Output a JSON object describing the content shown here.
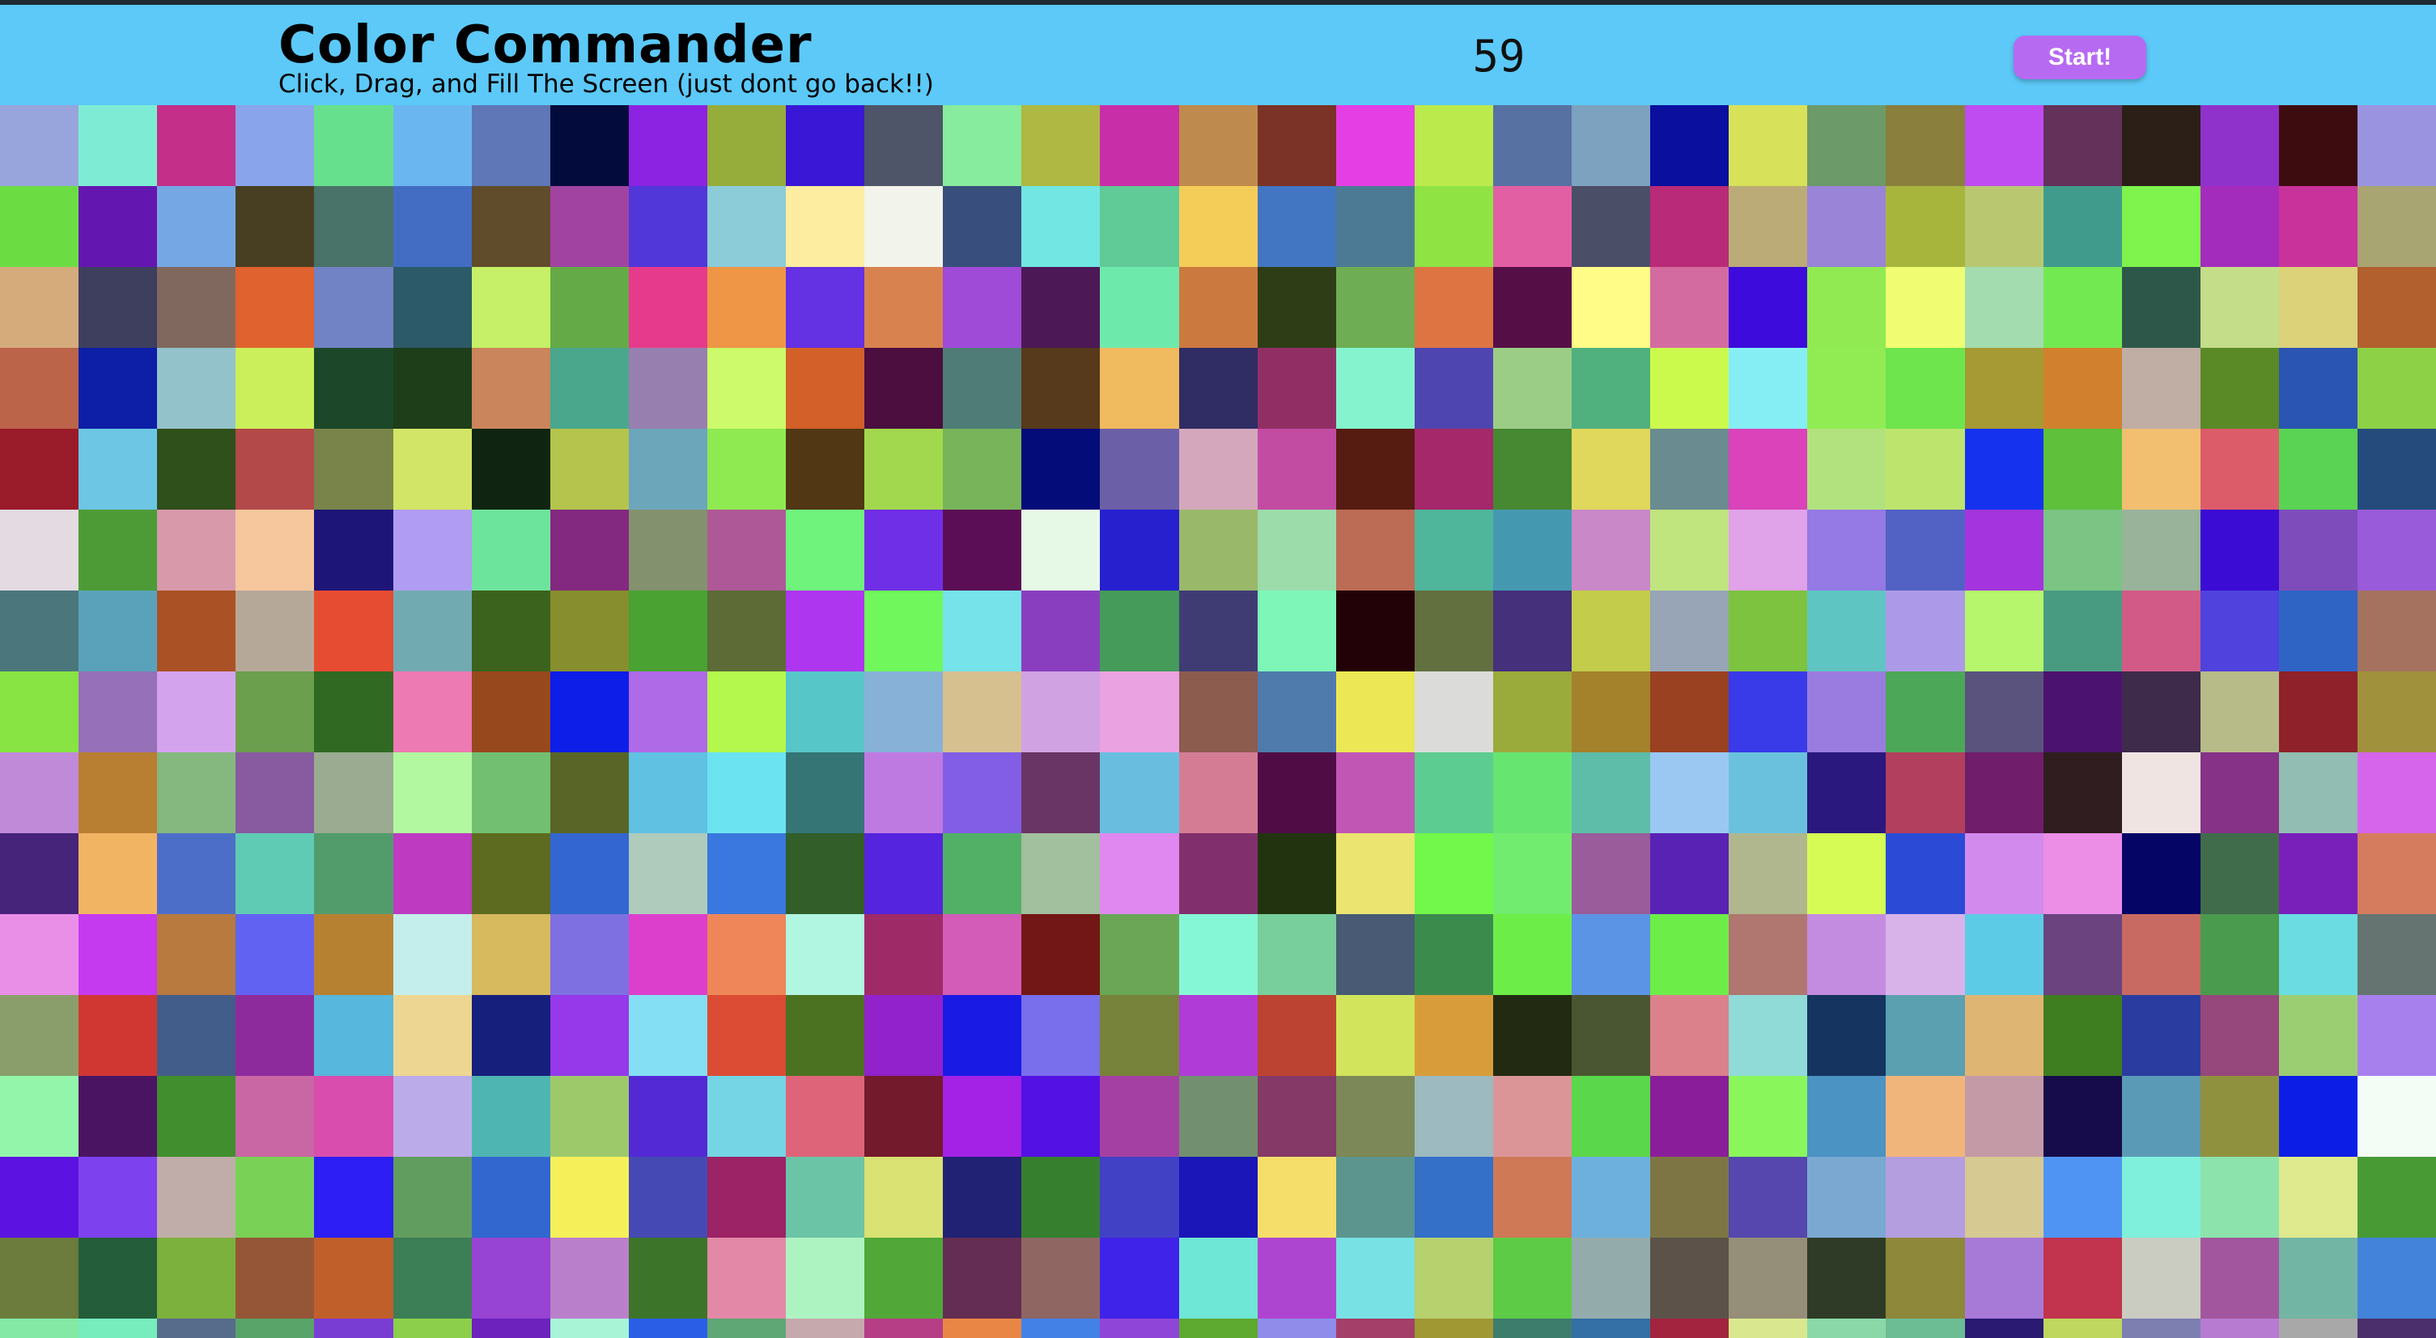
{
  "header": {
    "title": "Color Commander",
    "subtitle": "Click, Drag, and Fill The Screen (just dont go back!!)",
    "counter": "59",
    "start_label": "Start!"
  },
  "colors": {
    "header_bg": "#5cc9f8",
    "button_bg": "#b66af2",
    "top_border": "#1f2a33"
  },
  "grid": {
    "rows": [
      [
        "#98a5dc",
        "#7eecd4",
        "#c42f8a",
        "#8aa4ec",
        "#67e08d",
        "#6ab6f1",
        "#5f77b6",
        "#020b3c",
        "#8d23e2",
        "#96ad3c",
        "#3a16d7",
        "#4e5569",
        "#87ec9e",
        "#aeb842",
        "#c82ea7",
        "#bf8a4d",
        "#7b3227",
        "#e53ee5",
        "#bbea4d",
        "#5771a2",
        "#7ca2bf",
        "#0a0f9e",
        "#d8e15a",
        "#6d9a69",
        "#8a7f3c",
        "#bf4cf1",
        "#64315b",
        "#2b1f17",
        "#8f31cb",
        "#3d0c0e",
        "#9a94e0"
      ],
      [
        "#6bdd43",
        "#6417b0",
        "#76a7e5",
        "#483f22",
        "#497369",
        "#426dc3",
        "#604b2a",
        "#a143a1",
        "#5137d9",
        "#8ccbd8",
        "#fdeda0",
        "#f2f3ea",
        "#384e7c",
        "#72e6e2",
        "#60cb96",
        "#f3cd57",
        "#4276c3",
        "#4c7a94",
        "#8fe343",
        "#e25fa4",
        "#4a4e66",
        "#b92a79",
        "#bbab76",
        "#9a84d8",
        "#a7b53d",
        "#b9c771",
        "#419b8d",
        "#7ef44d",
        "#a42cbd",
        "#c9329a",
        "#a8a572"
      ],
      [
        "#d5ab7c",
        "#3e3e5f",
        "#81685e",
        "#e0622f",
        "#7183c5",
        "#2d5a68",
        "#c6f067",
        "#64ab47",
        "#e63b8c",
        "#ee9646",
        "#6431e3",
        "#d8834f",
        "#a04ad8",
        "#4c1856",
        "#6ee9ac",
        "#cc7940",
        "#2f3d16",
        "#6fad54",
        "#dd7442",
        "#560f46",
        "#fffc87",
        "#d36ba1",
        "#3d0cdc",
        "#91ea51",
        "#f0fd72",
        "#a3dcae",
        "#72e951",
        "#2d5849",
        "#c3dd88",
        "#dbd27a",
        "#b2602e"
      ],
      [
        "#bc6449",
        "#0d1fa6",
        "#93c2ca",
        "#cbee5b",
        "#1c4729",
        "#1d3e19",
        "#cb855c",
        "#4aa78c",
        "#977fb0",
        "#ccfa6a",
        "#d26028",
        "#4b0e3f",
        "#4f7c77",
        "#57391b",
        "#f0ba5e",
        "#302c64",
        "#912f64",
        "#85f3cd",
        "#4f45b0",
        "#9bcd87",
        "#50b07e",
        "#ccfa4c",
        "#85eef5",
        "#91ec54",
        "#6ee54d",
        "#a59a33",
        "#d1802e",
        "#c0ada4",
        "#598a26",
        "#2a55b2",
        "#8cd146"
      ],
      [
        "#9a1b2a",
        "#6cc6e4",
        "#30501b",
        "#b34949",
        "#78844a",
        "#d3e566",
        "#0f2512",
        "#b4c44c",
        "#6ca6bb",
        "#8fea52",
        "#513714",
        "#a2d84e",
        "#77b45a",
        "#040c79",
        "#6b5fa7",
        "#d4a7bc",
        "#c34ca3",
        "#561c12",
        "#a5286a",
        "#478833",
        "#e0d85c",
        "#6a8b90",
        "#da43b9",
        "#b2e27e",
        "#bde46c",
        "#1533ef",
        "#5ec03b",
        "#f2bf71",
        "#dc5c6a",
        "#5ad354",
        "#244b7c"
      ],
      [
        "#e3dae2",
        "#4d9b36",
        "#d899ab",
        "#f6c79d",
        "#1e1579",
        "#b09cf2",
        "#6de49c",
        "#83297f",
        "#84916e",
        "#ae5897",
        "#6ff37d",
        "#6f2fe6",
        "#5b0e55",
        "#e6f9e7",
        "#2620cf",
        "#9ab86a",
        "#9cdcab",
        "#bc6b55",
        "#4fb59b",
        "#4499b0",
        "#c988c7",
        "#c0e47e",
        "#e0a2e8",
        "#9579e5",
        "#5261c4",
        "#a435de",
        "#7bc484",
        "#98b39a",
        "#3b0cd4",
        "#7e4cbb",
        "#995bd9"
      ],
      [
        "#4b777c",
        "#5aa2ba",
        "#aa5225",
        "#b6a898",
        "#e64c32",
        "#72aab2",
        "#3c631d",
        "#868e2e",
        "#4aa232",
        "#5d6b37",
        "#ae36ee",
        "#70f75c",
        "#76e2e9",
        "#893ebf",
        "#449b5a",
        "#3f3c74",
        "#7df6b7",
        "#230207",
        "#627040",
        "#44307b",
        "#c3cc4b",
        "#97a5b6",
        "#7dc33f",
        "#5ec5c3",
        "#ac9ae8",
        "#b5f66c",
        "#489b81",
        "#d15b86",
        "#5042dc",
        "#2f64c5",
        "#a57260"
      ],
      [
        "#87e443",
        "#9670b9",
        "#d4a3ee",
        "#6b9e4d",
        "#306a22",
        "#ee7ab3",
        "#97481d",
        "#0c1ee8",
        "#af6ae8",
        "#b4f84d",
        "#57c6c9",
        "#87b1d6",
        "#d6c090",
        "#d0a2e2",
        "#eba2e0",
        "#8c5c4f",
        "#4e7aac",
        "#ece754",
        "#dbdcda",
        "#9aab3b",
        "#a3822b",
        "#9a4122",
        "#3a3be8",
        "#9a7be0",
        "#4da758",
        "#5a537d",
        "#4c1270",
        "#3e2a4b",
        "#b6bb88",
        "#8e2129",
        "#a0913c"
      ],
      [
        "#c08ad9",
        "#b87f33",
        "#84b87e",
        "#885aa0",
        "#9aab91",
        "#b1f8a0",
        "#73bf71",
        "#586527",
        "#60c1e2",
        "#6be3f1",
        "#367576",
        "#bf7ae2",
        "#815ee5",
        "#693565",
        "#69bedf",
        "#d57c95",
        "#500d45",
        "#c256b4",
        "#5dcc90",
        "#67e571",
        "#5dbda8",
        "#9ac8f2",
        "#6ac1de",
        "#2a187e",
        "#b23f5e",
        "#701d6b",
        "#2f1d1f",
        "#f0e4e2",
        "#853287",
        "#92bdb2",
        "#d765eb"
      ],
      [
        "#45247a",
        "#f1b463",
        "#4d6ec8",
        "#60cbb4",
        "#529c6c",
        "#be3bc1",
        "#5c6b1f",
        "#3366d0",
        "#aecbbb",
        "#3a77de",
        "#315e29",
        "#5524de",
        "#52b066",
        "#a2bf9e",
        "#e088ef",
        "#81306d",
        "#22340f",
        "#ebe471",
        "#72f84b",
        "#72ec6e",
        "#9a5c9a",
        "#5922b5",
        "#b0b78f",
        "#d6fb55",
        "#2b4bd7",
        "#d38aed",
        "#ec8de6",
        "#050566",
        "#416c4c",
        "#7920bb",
        "#d67c5e"
      ],
      [
        "#e98fe8",
        "#c63aef",
        "#b87a3e",
        "#6162f2",
        "#b68232",
        "#c4eeeb",
        "#d7b95e",
        "#7e70e0",
        "#dc3fcb",
        "#ee865a",
        "#b0f6e1",
        "#9e2a67",
        "#d25cb8",
        "#721715",
        "#6ba657",
        "#86f7d6",
        "#78cf9b",
        "#485a74",
        "#3b8c4c",
        "#6ced48",
        "#5b94e5",
        "#6ced47",
        "#b07670",
        "#c38ce0",
        "#d8b3ea",
        "#5ccbe6",
        "#6a437f",
        "#c96a62",
        "#4b9b4e",
        "#6bdde2",
        "#657470"
      ],
      [
        "#8a9e6b",
        "#d03732",
        "#435d8b",
        "#8e2b9c",
        "#57b7dc",
        "#ecd692",
        "#171f7d",
        "#9539ea",
        "#85dff4",
        "#dc4b33",
        "#4b7221",
        "#9122cc",
        "#1a1ae5",
        "#796eeb",
        "#77823a",
        "#b03bd6",
        "#bc4331",
        "#d2e45c",
        "#d89d3a",
        "#222b11",
        "#4a5631",
        "#db818b",
        "#90dbd7",
        "#153460",
        "#5aa0b0",
        "#dfb573",
        "#3f7d21",
        "#2a3ca0",
        "#96477c",
        "#9bce73",
        "#a880ee"
      ],
      [
        "#93f5a9",
        "#4b1463",
        "#418e2f",
        "#c967a4",
        "#d94daf",
        "#bcabe9",
        "#4fb5b3",
        "#9ec96b",
        "#5329d6",
        "#75d5e4",
        "#de6479",
        "#731a2c",
        "#a322e6",
        "#5311e4",
        "#a440a4",
        "#729070",
        "#843966",
        "#7c8858",
        "#9cbac0",
        "#dc9597",
        "#5ad74a",
        "#8a1e9a",
        "#89f75c",
        "#4a93c2",
        "#f0b57a",
        "#c39aa6",
        "#170c4b",
        "#5b9ab6",
        "#8f913e",
        "#0c1de6",
        "#f4fcf6"
      ],
      [
        "#5c12e1",
        "#7e41ee",
        "#c0ada9",
        "#79d155",
        "#2c1ef5",
        "#619d5e",
        "#3267d0",
        "#f5f059",
        "#4549b3",
        "#9b2366",
        "#6cc4a6",
        "#d9e272",
        "#212274",
        "#367f2f",
        "#4141c5",
        "#1a16b7",
        "#f5df6a",
        "#5c958e",
        "#346fc8",
        "#cf7957",
        "#6eb0dd",
        "#7d7644",
        "#5547ad",
        "#7aa8d1",
        "#b49ee0",
        "#d7c992",
        "#4f94f2",
        "#7ff0db",
        "#8ce3ab",
        "#dfe98e",
        "#489a35"
      ],
      [
        "#6b7c3c",
        "#245d3a",
        "#7cb13d",
        "#955637",
        "#c15f2b",
        "#3c7e55",
        "#9743d3",
        "#ba7fcb",
        "#3c7529",
        "#e488a8",
        "#adf3c1",
        "#51a839",
        "#632d54",
        "#8f6662",
        "#3f23e8",
        "#6ee7d6",
        "#ae45d0",
        "#77e1e4",
        "#b6d16e",
        "#5dcb45",
        "#94abac",
        "#5c5249",
        "#958e78",
        "#303b27",
        "#8d883a",
        "#a87ad8",
        "#c2334e",
        "#cacbc1",
        "#a2569d",
        "#73b5a4",
        "#4483da"
      ],
      [
        "#83e9a4",
        "#77ecbc",
        "#566c8a",
        "#59a468",
        "#7a3dd3",
        "#8bcf4b",
        "#6d21bd",
        "#a8f4d6",
        "#2a5ee6",
        "#60a776",
        "#c6a9ad",
        "#b63e86",
        "#e98646",
        "#4381e6",
        "#8e45d8",
        "#5ea930",
        "#8f8cea",
        "#a33f69",
        "#9f9833",
        "#3d7d6c",
        "#3470a5",
        "#a2243f",
        "#d9e88e",
        "#8ad8a8",
        "#6cbd93",
        "#2a1a72",
        "#bfd65f",
        "#7d7fb1",
        "#b77bd1",
        "#a9a8a8",
        "#4a2f6c"
      ]
    ]
  }
}
